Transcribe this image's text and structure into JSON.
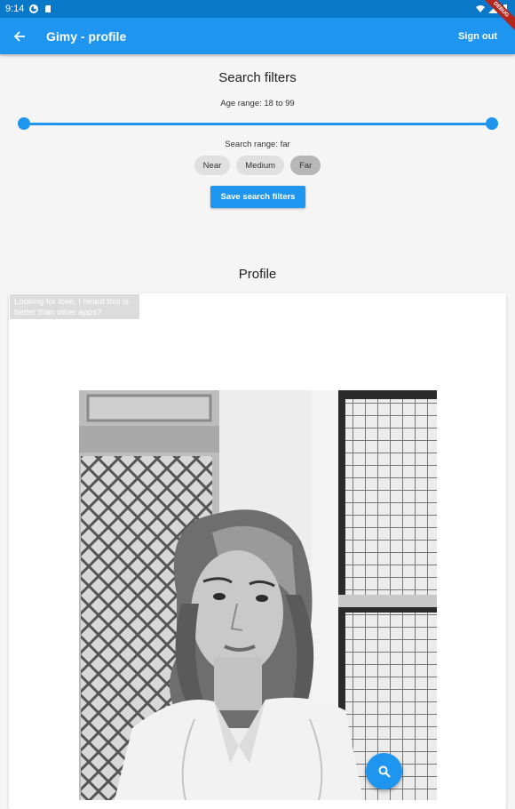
{
  "status_bar": {
    "time": "9:14"
  },
  "app_bar": {
    "title": "Gimy - profile",
    "sign_out": "Sign out",
    "debug_banner": "DEBUG"
  },
  "filters": {
    "title": "Search filters",
    "age_range_text": "Age range: 18 to 99",
    "age_min": 18,
    "age_max": 99,
    "search_range_text": "Search range: far",
    "range_options": [
      "Near",
      "Medium",
      "Far"
    ],
    "selected_range": "Far",
    "save_label": "Save search filters"
  },
  "profile": {
    "title": "Profile",
    "bio": "Looking for love, I heard this is better than other apps?"
  },
  "colors": {
    "primary": "#1e96f0",
    "status_bar": "#0a78c9"
  },
  "icons": {
    "back": "arrow-back-icon",
    "fab": "search-icon"
  }
}
